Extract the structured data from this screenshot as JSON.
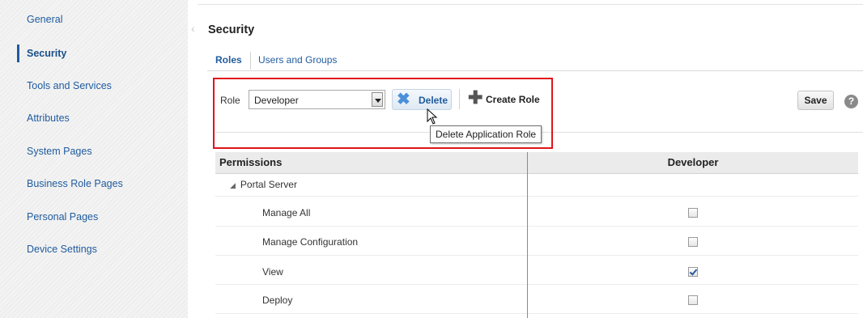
{
  "sidebar": {
    "items": [
      {
        "label": "General"
      },
      {
        "label": "Security"
      },
      {
        "label": "Tools and Services"
      },
      {
        "label": "Attributes"
      },
      {
        "label": "System Pages"
      },
      {
        "label": "Business Role Pages"
      },
      {
        "label": "Personal Pages"
      },
      {
        "label": "Device Settings"
      }
    ],
    "active": "Security"
  },
  "page": {
    "title": "Security"
  },
  "tabs": [
    {
      "label": "Roles",
      "active": true
    },
    {
      "label": "Users and Groups",
      "active": false
    }
  ],
  "toolbar": {
    "role_label": "Role",
    "role_value": "Developer",
    "delete_label": "Delete",
    "create_label": "Create Role",
    "save_label": "Save",
    "help_symbol": "?",
    "tooltip": "Delete Application Role"
  },
  "table": {
    "columns": [
      "Permissions",
      "Developer"
    ],
    "group": "Portal Server",
    "rows": [
      {
        "label": "Manage All",
        "checked": false
      },
      {
        "label": "Manage Configuration",
        "checked": false
      },
      {
        "label": "View",
        "checked": true
      },
      {
        "label": "Deploy",
        "checked": false
      }
    ]
  },
  "icons": {
    "delete": "x-icon",
    "create": "plus-icon",
    "help": "help-icon",
    "expand": "triangle-down-icon"
  },
  "colors": {
    "accent": "#1f5b9e",
    "highlight_border": "#e0141a",
    "column_divider": "#3aa8c7"
  }
}
